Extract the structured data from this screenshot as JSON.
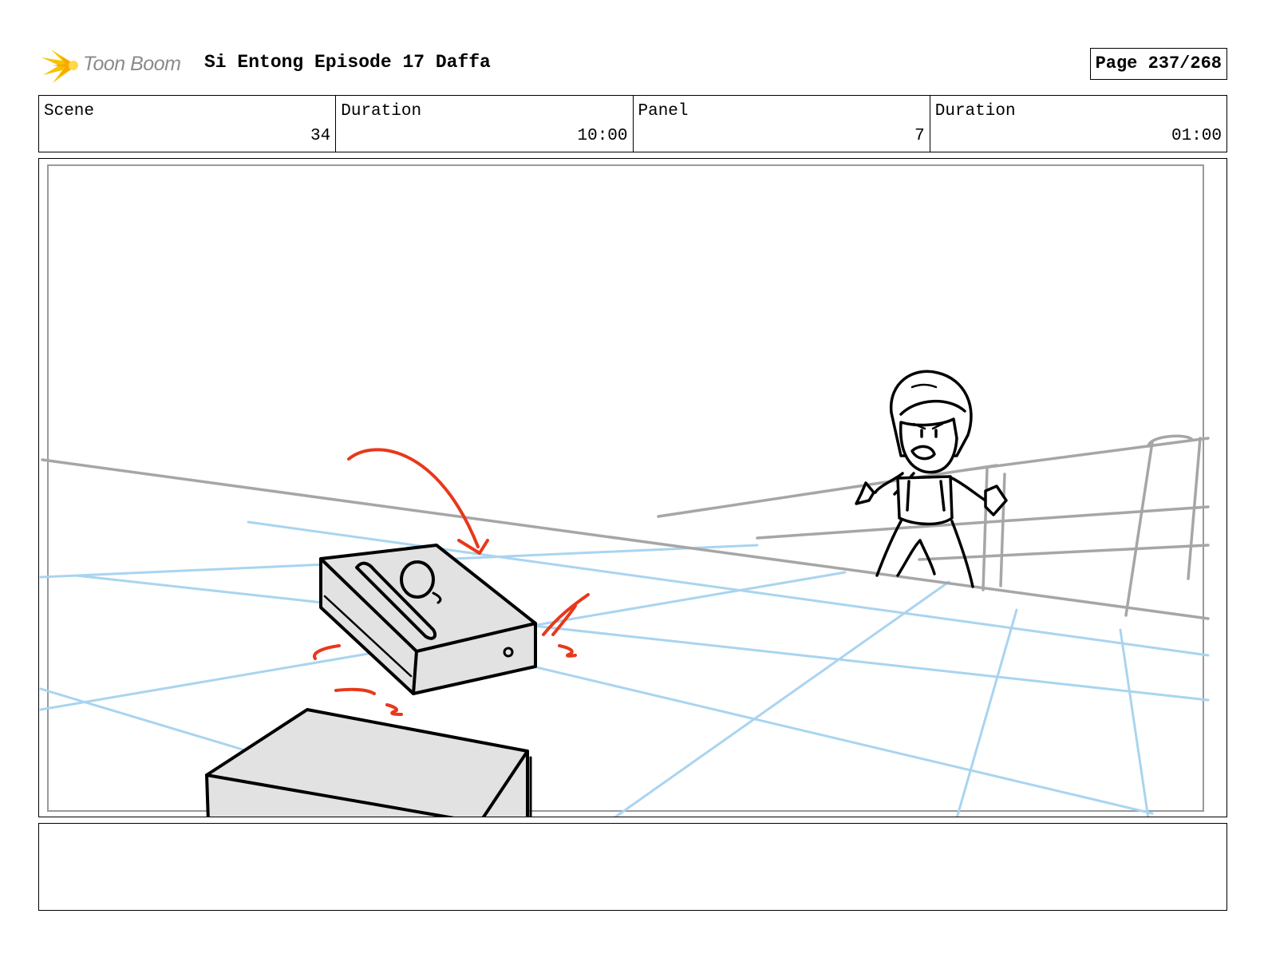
{
  "header": {
    "logo_text": "Toon Boom",
    "project_title": "Si Entong Episode 17 Daffa",
    "page_label": "Page 237/268"
  },
  "info": {
    "scene_label": "Scene",
    "scene_value": "34",
    "scene_duration_label": "Duration",
    "scene_duration_value": "10:00",
    "panel_label": "Panel",
    "panel_value": "7",
    "panel_duration_label": "Duration",
    "panel_duration_value": "01:00"
  },
  "colors": {
    "sketch_line": "#000000",
    "guide_blue": "#a9d4f0",
    "guide_gray": "#a6a6a6",
    "action_red": "#e8381b",
    "fill_gray": "#e2e2e2",
    "logo_yellow": "#f5c400"
  },
  "notes": {
    "text": ""
  }
}
